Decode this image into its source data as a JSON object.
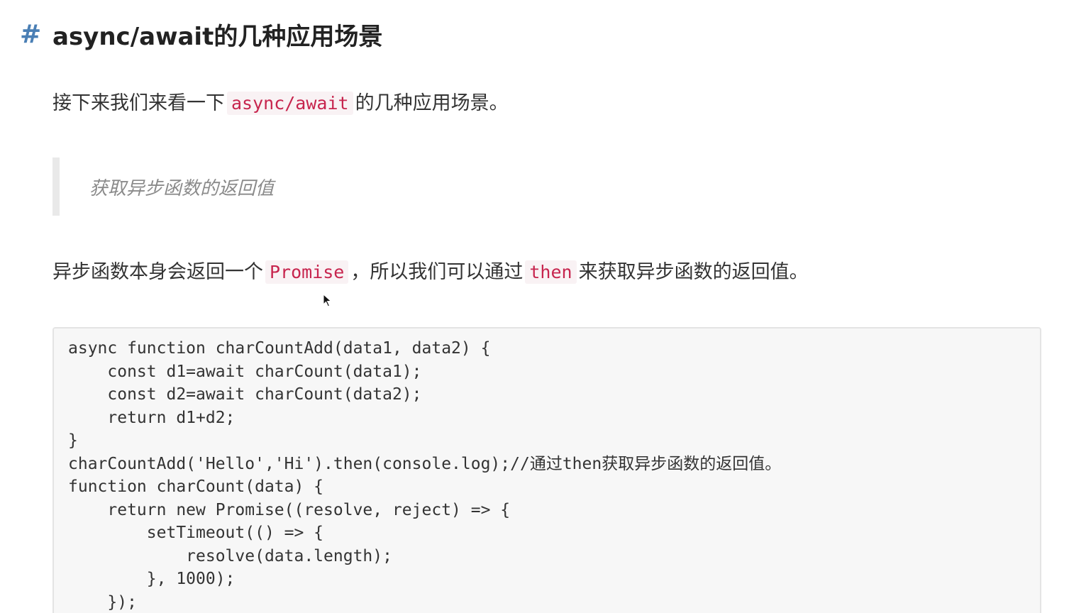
{
  "heading": {
    "hash": "#",
    "title": "async/await的几种应用场景"
  },
  "intro": {
    "before": "接下来我们来看一下",
    "code": "async/await",
    "after": "的几种应用场景。"
  },
  "blockquote": {
    "text": "获取异步函数的返回值"
  },
  "description": {
    "part1": "异步函数本身会返回一个",
    "code1": "Promise",
    "part2": "，所以我们可以通过",
    "code2": "then",
    "part3": "来获取异步函数的返回值。"
  },
  "code_block": {
    "lines": [
      "async function charCountAdd(data1, data2) {",
      "    const d1=await charCount(data1);",
      "    const d2=await charCount(data2);",
      "    return d1+d2;",
      "}",
      "charCountAdd('Hello','Hi').then(console.log);//通过then获取异步函数的返回值。",
      "function charCount(data) {",
      "    return new Promise((resolve, reject) => {",
      "        setTimeout(() => {",
      "            resolve(data.length);",
      "        }, 1000);",
      "    });"
    ]
  },
  "icons": {
    "cursor": "mouse-pointer-icon"
  },
  "colors": {
    "hash": "#4a7fb5",
    "inline_code": "#c7254e",
    "inline_code_bg": "#f9f2f4",
    "code_bg": "#f7f7f7"
  }
}
